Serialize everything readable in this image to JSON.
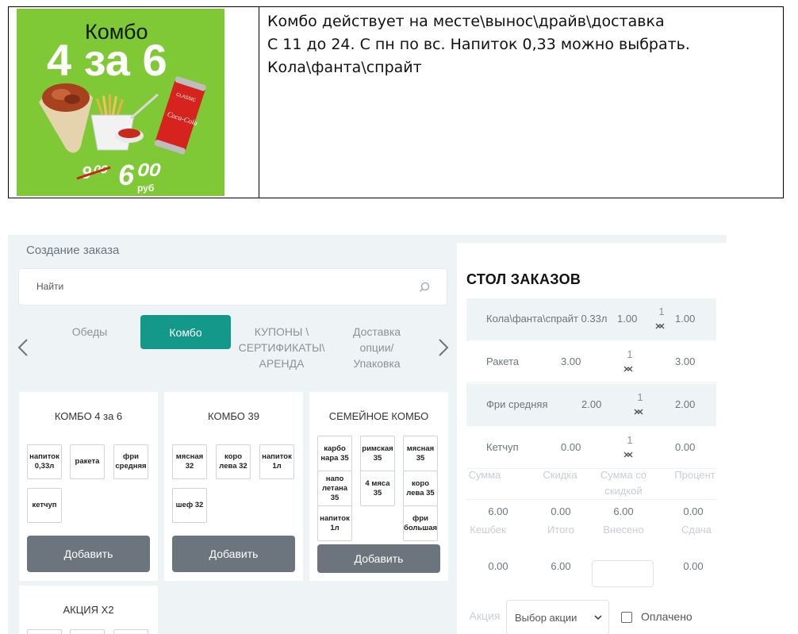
{
  "promo": {
    "banner": {
      "title": "Комбо",
      "headline": "4 за 6",
      "old_price": "9⁰⁰",
      "new_price": "6⁰⁰",
      "currency": "руб",
      "can_label": "CLASSIC",
      "brand": "Coca-Cola",
      "bg_color": "#80c936"
    },
    "lines": [
      "Комбо действует на месте\\вынос\\драйв\\доставка",
      "С 11 до 24. С пн по вс. Напиток 0,33 можно выбрать.",
      "Кола\\фанта\\спрайт"
    ]
  },
  "app": {
    "page_title": "Создание заказа",
    "search": {
      "placeholder": "Найти"
    },
    "tabs": [
      {
        "label": "Обеды"
      },
      {
        "label": "Комбо",
        "active": true
      },
      {
        "label": "КУПОНЫ \\ СЕРТИФИКАТЫ\\ АРЕНДА"
      },
      {
        "label": "Доставка опции/ Упаковка"
      }
    ],
    "cards": [
      {
        "title": "КОМБО 4 за 6",
        "items": [
          "напиток\n0,33л",
          "ракета",
          "фри\nсредняя",
          "кетчуп"
        ],
        "add_label": "Добавить"
      },
      {
        "title": "КОМБО 39",
        "items": [
          "мясная\n32",
          "коро\nлева 32",
          "напиток\n1л",
          "шеф 32"
        ],
        "add_label": "Добавить"
      },
      {
        "title": "СЕМЕЙНОЕ КОМБО",
        "items": [
          "карбо\nнара 35",
          "римская\n35",
          "мясная\n35",
          "напо\nлетана\n35",
          "4 мяса\n35",
          "коро\nлева 35",
          "напиток\n1л",
          "фри\nбольшая"
        ],
        "add_label": "Добавить"
      },
      {
        "title": "АКЦИЯ Х2"
      }
    ],
    "order": {
      "title": "СТОЛ ЗАКАЗОВ",
      "rows": [
        {
          "name": "Кола\\фанта\\спрайт 0.33л",
          "price": "1.00",
          "qty": "1",
          "total": "1.00"
        },
        {
          "name": "Ракета",
          "price": "3.00",
          "qty": "1",
          "total": "3.00"
        },
        {
          "name": "Фри средняя",
          "price": "2.00",
          "qty": "1",
          "total": "2.00"
        },
        {
          "name": "Кетчуп",
          "price": "0.00",
          "qty": "1",
          "total": "0.00"
        }
      ],
      "summary_labels": [
        "Сумма",
        "Скидка",
        "Сумма со скидкой",
        "Процент"
      ],
      "summary_values": [
        "6.00",
        "0.00",
        "6.00",
        "0.00"
      ],
      "payment_labels": [
        "Кешбек",
        "Итого",
        "Внесено",
        "Сдача"
      ],
      "payment_values": [
        "0.00",
        "6.00",
        "",
        "0.00"
      ],
      "promo_label": "Акция",
      "promo_select": "Выбор акции",
      "paid_label": "Оплачено"
    }
  }
}
